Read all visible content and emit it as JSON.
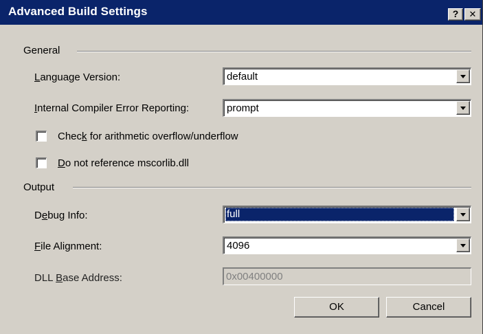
{
  "dialog": {
    "title": "Advanced Build Settings",
    "help_button": "?",
    "close_button": "✕"
  },
  "general": {
    "label": "General",
    "language_version": {
      "label": "Language Version:",
      "value": "default"
    },
    "ice_reporting": {
      "label": "Internal Compiler Error Reporting:",
      "value": "prompt"
    },
    "overflow_check": {
      "label": "Check for arithmetic overflow/underflow",
      "checked": false
    },
    "no_mscorlib": {
      "label": "Do not reference mscorlib.dll",
      "checked": false
    }
  },
  "output": {
    "label": "Output",
    "debug_info": {
      "label": "Debug Info:",
      "value": "full"
    },
    "file_alignment": {
      "label": "File Alignment:",
      "value": "4096"
    },
    "dll_base_address": {
      "label": "DLL Base Address:",
      "value": "0x00400000"
    }
  },
  "buttons": {
    "ok": "OK",
    "cancel": "Cancel"
  },
  "colors": {
    "titlebar": "#0a246a",
    "face": "#d4d0c8",
    "selection": "#0a246a"
  }
}
